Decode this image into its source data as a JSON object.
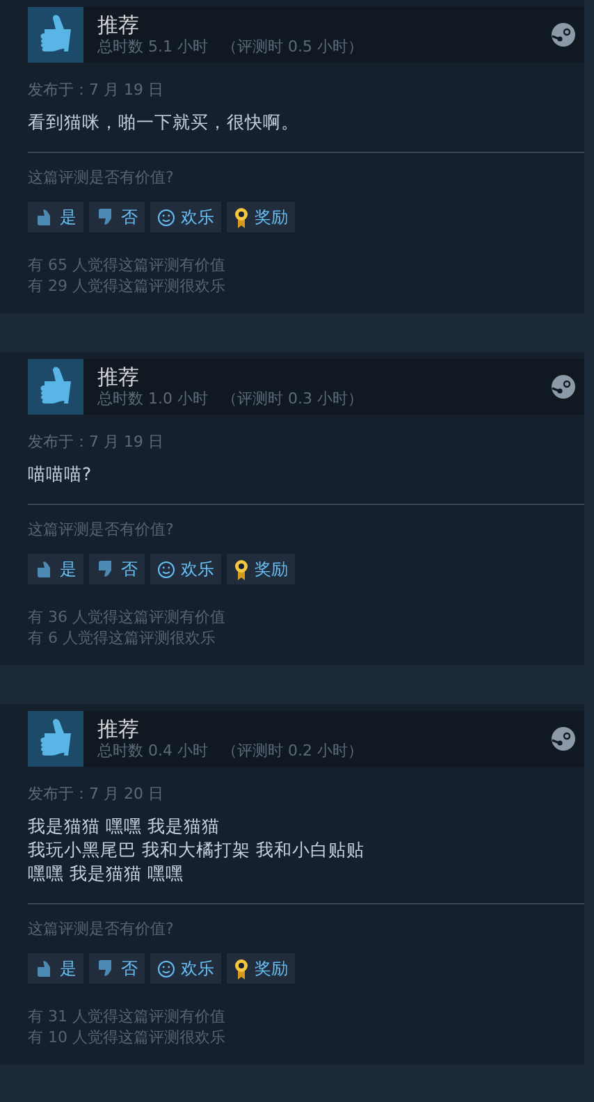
{
  "reviews": [
    {
      "verdict": "推荐",
      "playtime": "总时数 5.1 小时",
      "review_time": "（评测时 0.5 小时）",
      "posted": "发布于：7 月 19 日",
      "text": [
        "看到猫咪，啪一下就买，很快啊。"
      ],
      "question": "这篇评测是否有价值?",
      "buttons": [
        {
          "kind": "yes",
          "label": "是"
        },
        {
          "kind": "no",
          "label": "否"
        },
        {
          "kind": "funny",
          "label": "欢乐"
        },
        {
          "kind": "award",
          "label": "奖励"
        }
      ],
      "counts": [
        "有 65 人觉得这篇评测有价值",
        "有 29 人觉得这篇评测很欢乐"
      ]
    },
    {
      "verdict": "推荐",
      "playtime": "总时数 1.0 小时",
      "review_time": "（评测时 0.3 小时）",
      "posted": "发布于：7 月 19 日",
      "text": [
        "喵喵喵?"
      ],
      "question": "这篇评测是否有价值?",
      "buttons": [
        {
          "kind": "yes",
          "label": "是"
        },
        {
          "kind": "no",
          "label": "否"
        },
        {
          "kind": "funny",
          "label": "欢乐"
        },
        {
          "kind": "award",
          "label": "奖励"
        }
      ],
      "counts": [
        "有 36 人觉得这篇评测有价值",
        "有 6 人觉得这篇评测很欢乐"
      ]
    },
    {
      "verdict": "推荐",
      "playtime": "总时数 0.4 小时",
      "review_time": "（评测时 0.2 小时）",
      "posted": "发布于：7 月 20 日",
      "text": [
        "我是猫猫 嘿嘿 我是猫猫",
        "我玩小黑尾巴 我和大橘打架 我和小白贴贴",
        "嘿嘿 我是猫猫 嘿嘿"
      ],
      "question": "这篇评测是否有价值?",
      "buttons": [
        {
          "kind": "yes",
          "label": "是"
        },
        {
          "kind": "no",
          "label": "否"
        },
        {
          "kind": "funny",
          "label": "欢乐"
        },
        {
          "kind": "award",
          "label": "奖励"
        }
      ],
      "counts": [
        "有 31 人觉得这篇评测有价值",
        "有 10 人觉得这篇评测很欢乐"
      ]
    }
  ]
}
